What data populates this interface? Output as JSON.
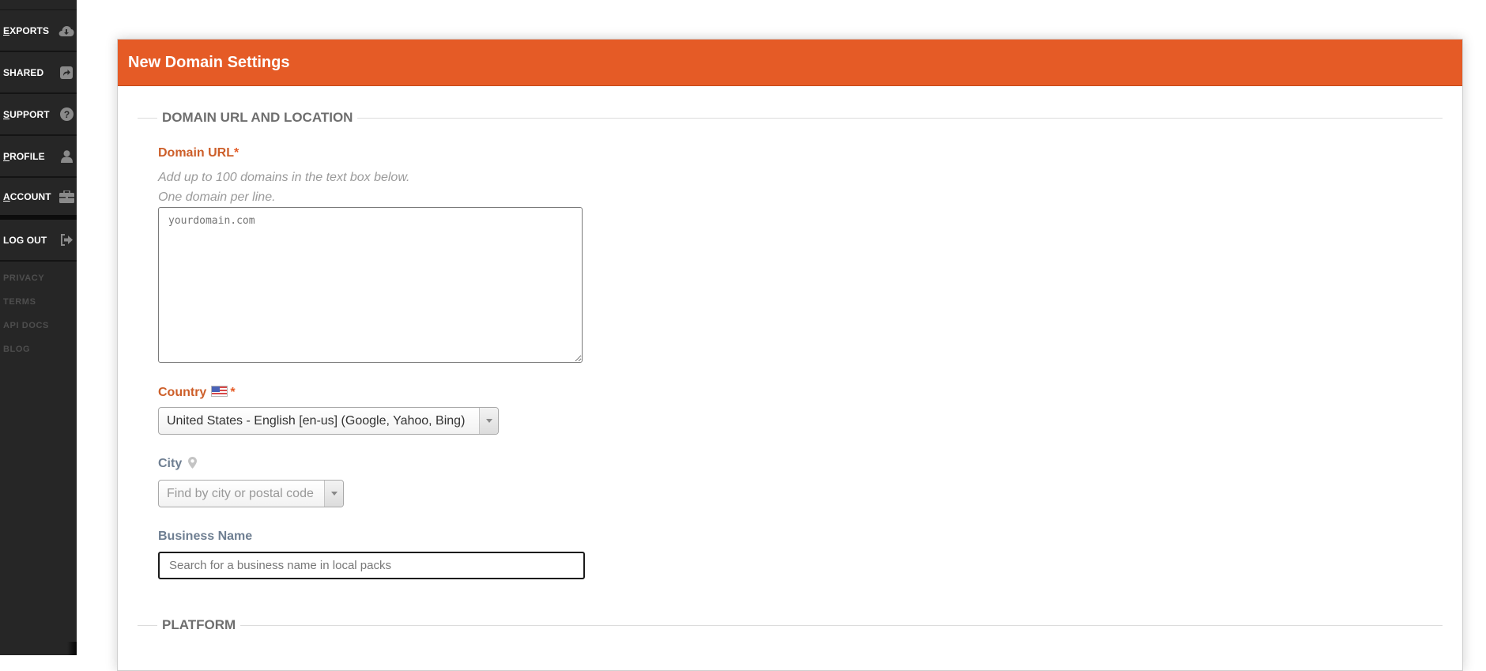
{
  "sidebar": {
    "items": [
      {
        "label": "EXPORTS",
        "accesskey": "E",
        "rest": "XPORTS",
        "icon": "cloud-download-icon"
      },
      {
        "label": "SHARED",
        "accesskey": "",
        "rest": "SHARED",
        "icon": "share-icon"
      },
      {
        "label": "SUPPORT",
        "accesskey": "S",
        "rest": "UPPORT",
        "icon": "question-circle-icon"
      },
      {
        "label": "PROFILE",
        "accesskey": "P",
        "rest": "ROFILE",
        "icon": "user-icon"
      },
      {
        "label": "ACCOUNT",
        "accesskey": "A",
        "rest": "CCOUNT",
        "icon": "briefcase-icon"
      },
      {
        "label": "LOG OUT",
        "accesskey": "",
        "rest": "LOG OUT",
        "icon": "sign-out-icon"
      }
    ],
    "footer_links": [
      "PRIVACY",
      "TERMS",
      "API DOCS",
      "BLOG"
    ]
  },
  "panel": {
    "title": "New Domain Settings",
    "accent_color": "#e55b26",
    "sections": {
      "domain": {
        "legend": "DOMAIN URL AND LOCATION",
        "domain_url": {
          "label": "Domain URL",
          "required_mark": "*",
          "hint_line1": "Add up to 100 domains in the text box below.",
          "hint_line2": "One domain per line.",
          "placeholder": "yourdomain.com",
          "value": ""
        },
        "country": {
          "label": "Country",
          "flag_icon": "us-flag-icon",
          "required_mark": "*",
          "selected": "United States - English [en-us] (Google, Yahoo, Bing)"
        },
        "city": {
          "label": "City",
          "icon": "map-marker-icon",
          "placeholder": "Find by city or postal code"
        },
        "business_name": {
          "label": "Business Name",
          "placeholder": "Search for a business name in local packs",
          "value": ""
        }
      },
      "platform": {
        "legend": "PLATFORM"
      }
    }
  }
}
